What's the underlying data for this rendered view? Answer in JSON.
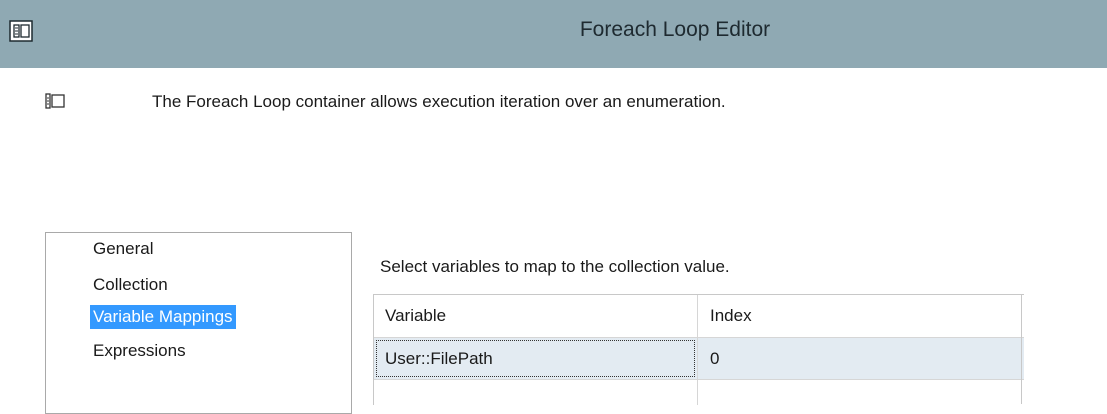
{
  "window": {
    "title": "Foreach Loop Editor",
    "app_icon": "foreach-loop-icon"
  },
  "header": {
    "description": "The Foreach Loop container allows execution iteration over an enumeration.",
    "icon": "foreach-loop-icon"
  },
  "nav": {
    "items": [
      {
        "label": "General",
        "selected": false
      },
      {
        "label": "Collection",
        "selected": false
      },
      {
        "label": "Variable Mappings",
        "selected": true
      },
      {
        "label": "Expressions",
        "selected": false
      }
    ]
  },
  "mappings": {
    "prompt": "Select variables to map to the collection value.",
    "columns": [
      "Variable",
      "Index"
    ],
    "rows": [
      {
        "variable": "User::FilePath",
        "index": "0"
      }
    ]
  }
}
